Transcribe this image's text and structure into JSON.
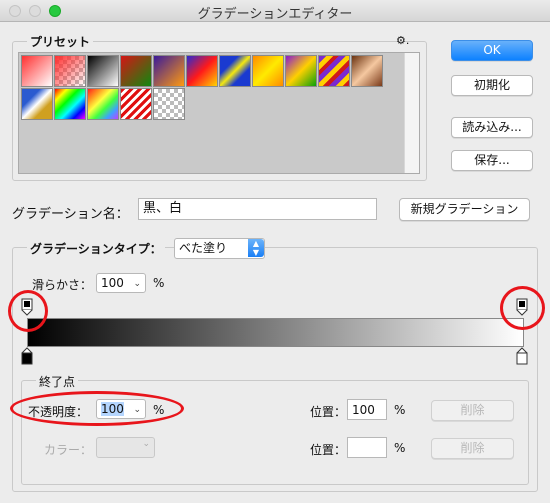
{
  "window": {
    "title": "グラデーションエディター"
  },
  "presets": {
    "legend": "プリセット",
    "gear_label": "⚙."
  },
  "buttons": {
    "ok": "OK",
    "reset": "初期化",
    "load": "読み込み...",
    "save": "保存...",
    "new_gradient": "新規グラデーション",
    "delete": "削除"
  },
  "name_row": {
    "label": "グラデーション名：",
    "value": "黒、白"
  },
  "type_row": {
    "label": "グラデーションタイプ：",
    "value": "べた塗り"
  },
  "smooth_row": {
    "label": "滑らかさ：",
    "value": "100",
    "unit": "%"
  },
  "stops": {
    "legend": "終了点",
    "opacity_label": "不透明度：",
    "opacity_value": "100",
    "opacity_unit": "%",
    "location_label": "位置：",
    "location_value": "100",
    "location_unit": "%",
    "color_label": "カラー：",
    "color_location_label": "位置：",
    "color_location_value": "",
    "color_location_unit": "%"
  },
  "colors": {
    "annotation": "#e8151b",
    "accent": "#0d81ff"
  }
}
